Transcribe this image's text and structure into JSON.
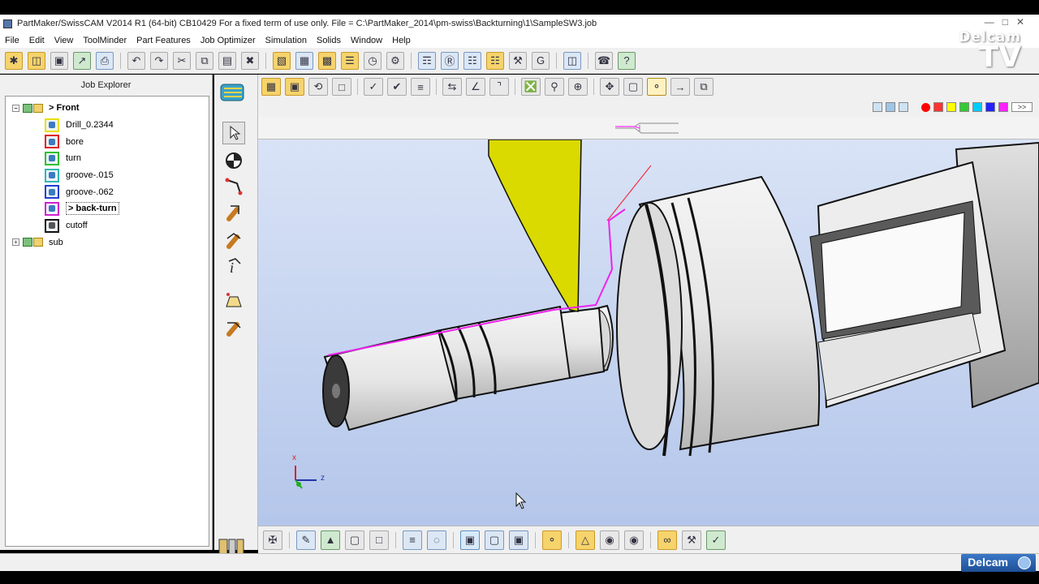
{
  "window": {
    "title": "PartMaker/SwissCAM V2014 R1 (64-bit) CB10429  For a fixed term of use only.    File = C:\\PartMaker_2014\\pm-swiss\\Backturning\\1\\SampleSW3.job"
  },
  "menu": [
    "File",
    "Edit",
    "View",
    "ToolMinder",
    "Part Features",
    "Job Optimizer",
    "Simulation",
    "Solids",
    "Window",
    "Help"
  ],
  "logo": {
    "line1": "Delcam",
    "line2": "TV"
  },
  "explorer": {
    "title": "Job Explorer",
    "front": "> Front",
    "sub": "sub",
    "items": [
      {
        "label": "Drill_0.2344",
        "color": "#e8e000"
      },
      {
        "label": "bore",
        "color": "#e02020"
      },
      {
        "label": "turn",
        "color": "#30c030"
      },
      {
        "label": "groove-.015",
        "color": "#30b8b0"
      },
      {
        "label": "groove-.062",
        "color": "#2040d0"
      },
      {
        "label": "> back-turn",
        "color": "#d020d0"
      },
      {
        "label": "cutoff",
        "color": "#111111"
      }
    ]
  },
  "palette": [
    "#ff0000",
    "#ff3333",
    "#ffff00",
    "#33cc33",
    "#00ccff",
    "#2222ff",
    "#ff22ff"
  ],
  "palette_more": ">>",
  "viewport": {
    "axis_x": "x",
    "axis_z": "z"
  },
  "status": {
    "brand": "Delcam"
  }
}
